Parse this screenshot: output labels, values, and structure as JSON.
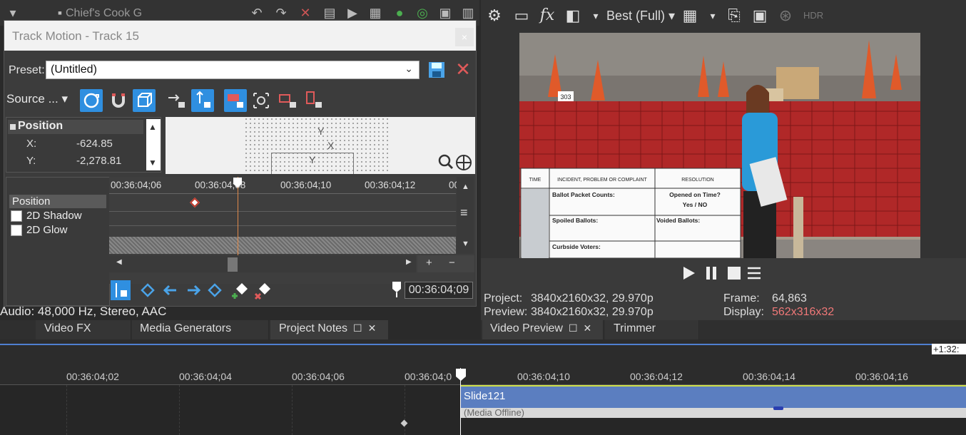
{
  "app": {
    "doc_title": "Chief's Cook G"
  },
  "track_motion": {
    "title": "Track Motion - Track 15",
    "close_glyph": "×",
    "preset_label": "Preset:",
    "preset_value": "(Untitled)",
    "source_label": "Source ...",
    "position": {
      "header": "Position",
      "x_label": "X:",
      "x_value": "-624.85",
      "y_label": "Y:",
      "y_value": "-2,278.81"
    },
    "axis": {
      "y": "Y",
      "x": "X"
    },
    "tracks": [
      {
        "label": "Position",
        "selected": true
      },
      {
        "label": "2D Shadow",
        "selected": false
      },
      {
        "label": "2D Glow",
        "selected": false
      }
    ],
    "ruler_ticks": [
      "00:36:04;06",
      "00:36:04;08",
      "00:36:04;10",
      "00:36:04;12",
      "00"
    ],
    "zoom_plus": "+",
    "zoom_minus": "−",
    "current_time": "00:36:04;09"
  },
  "audio_info": "Audio: 48,000 Hz, Stereo, AAC",
  "left_tabs": [
    {
      "label": "Video FX"
    },
    {
      "label": "Media Generators"
    },
    {
      "label": "Project Notes"
    }
  ],
  "preview": {
    "quality": "Best (Full)",
    "project_label": "Project:",
    "project_value": "3840x2160x32, 29.970p",
    "preview_label": "Preview:",
    "preview_value": "3840x2160x32, 29.970p",
    "frame_label": "Frame:",
    "frame_value": "64,863",
    "display_label": "Display:",
    "display_value": "562x316x32",
    "display_color": "#f07878",
    "form": {
      "col1": "TIME",
      "col2": "INCIDENT, PROBLEM OR COMPLAINT",
      "col3": "RESOLUTION",
      "row1a": "Ballot Packet Counts:",
      "row1b": "Opened on Time?",
      "row1c": "Yes / NO",
      "row2a": "Spoiled Ballots:",
      "row2b": "Voided Ballots:",
      "row3a": "Curbside Voters:"
    },
    "cage_label": "303"
  },
  "right_tabs": [
    {
      "label": "Video Preview"
    },
    {
      "label": "Trimmer"
    }
  ],
  "timeline": {
    "end_label": "+1:32:",
    "ticks": [
      "00:36:04;02",
      "00:36:04;04",
      "00:36:04;06",
      "00:36:04;0",
      "00:36:04;10",
      "00:36:04;12",
      "00:36:04;14",
      "00:36:04;16"
    ],
    "clip_name": "Slide121",
    "clip_status": "(Media Offline)"
  },
  "colors": {
    "accent_blue": "#2f8fe0",
    "clip_blue": "#5b7ec0",
    "cursor_orange": "#e08a4a"
  }
}
